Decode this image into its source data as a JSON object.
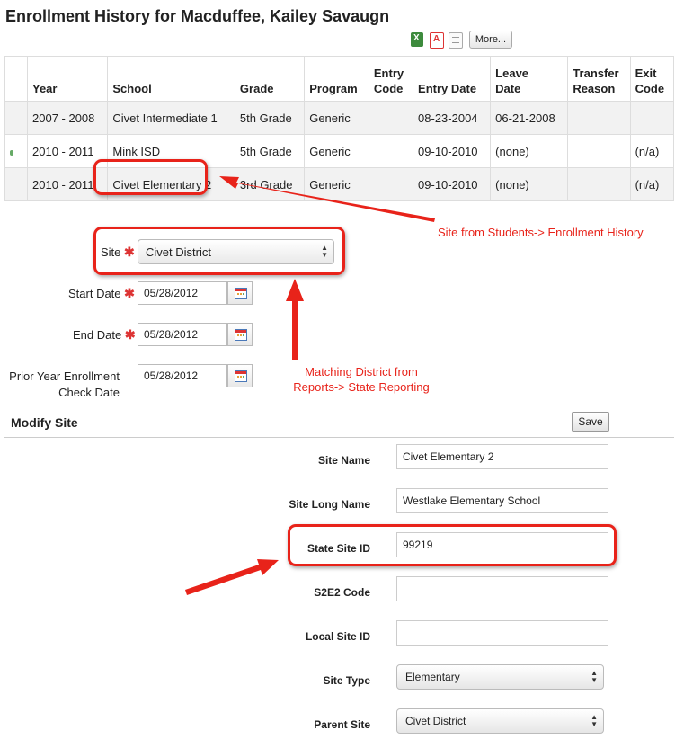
{
  "page": {
    "title": "Enrollment History for Macduffee, Kailey Savaugn"
  },
  "toolbar": {
    "more_label": "More..."
  },
  "icons": {
    "excel": "excel-icon",
    "pdf": "pdf-icon",
    "document": "document-icon",
    "calendar": "calendar-icon",
    "active_dot": "active-dot-icon"
  },
  "table": {
    "columns": [
      "Year",
      "School",
      "Grade",
      "Program",
      "Entry Code",
      "Entry Date",
      "Leave Date",
      "Transfer Reason",
      "Exit Code"
    ],
    "column_lines": [
      [
        "Year"
      ],
      [
        "School"
      ],
      [
        "Grade"
      ],
      [
        "Program"
      ],
      [
        "Entry",
        "Code"
      ],
      [
        "Entry Date"
      ],
      [
        "Leave",
        "Date"
      ],
      [
        "Transfer",
        "Reason"
      ],
      [
        "Exit",
        "Code"
      ]
    ],
    "rows": [
      {
        "active": false,
        "cells": [
          "2007 - 2008",
          "Civet Intermediate 1",
          "5th Grade",
          "Generic",
          "",
          "08-23-2004",
          "06-21-2008",
          "",
          ""
        ]
      },
      {
        "active": true,
        "cells": [
          "2010 - 2011",
          "Mink ISD",
          "5th Grade",
          "Generic",
          "",
          "09-10-2010",
          "(none)",
          "",
          "(n/a)"
        ]
      },
      {
        "active": false,
        "cells": [
          "2010 - 2011",
          "Civet Elementary 2",
          "3rd Grade",
          "Generic",
          "",
          "09-10-2010",
          "(none)",
          "",
          "(n/a)"
        ]
      }
    ]
  },
  "filters": {
    "site_label": "Site",
    "site_value": "Civet District",
    "start_date_label": "Start Date",
    "start_date_value": "05/28/2012",
    "end_date_label": "End Date",
    "end_date_value": "05/28/2012",
    "prior_year_label_line1": "Prior Year Enrollment",
    "prior_year_label_line2": "Check Date",
    "prior_year_value": "05/28/2012",
    "required_marker": "✱"
  },
  "modify_site": {
    "title": "Modify Site",
    "save_label": "Save",
    "site_name_label": "Site Name",
    "site_name_value": "Civet Elementary 2",
    "site_long_name_label": "Site Long Name",
    "site_long_name_value": "Westlake Elementary School",
    "state_site_id_label": "State Site ID",
    "state_site_id_value": "99219",
    "s2e2_code_label": "S2E2 Code",
    "s2e2_code_value": "",
    "local_site_id_label": "Local Site ID",
    "local_site_id_value": "",
    "site_type_label": "Site Type",
    "site_type_value": "Elementary",
    "parent_site_label": "Parent Site",
    "parent_site_value": "Civet District"
  },
  "annotations": {
    "note1": "Site from Students-> Enrollment History",
    "note2_line1": "Matching District from",
    "note2_line2": "Reports-> State Reporting",
    "color": "#e8231a"
  }
}
